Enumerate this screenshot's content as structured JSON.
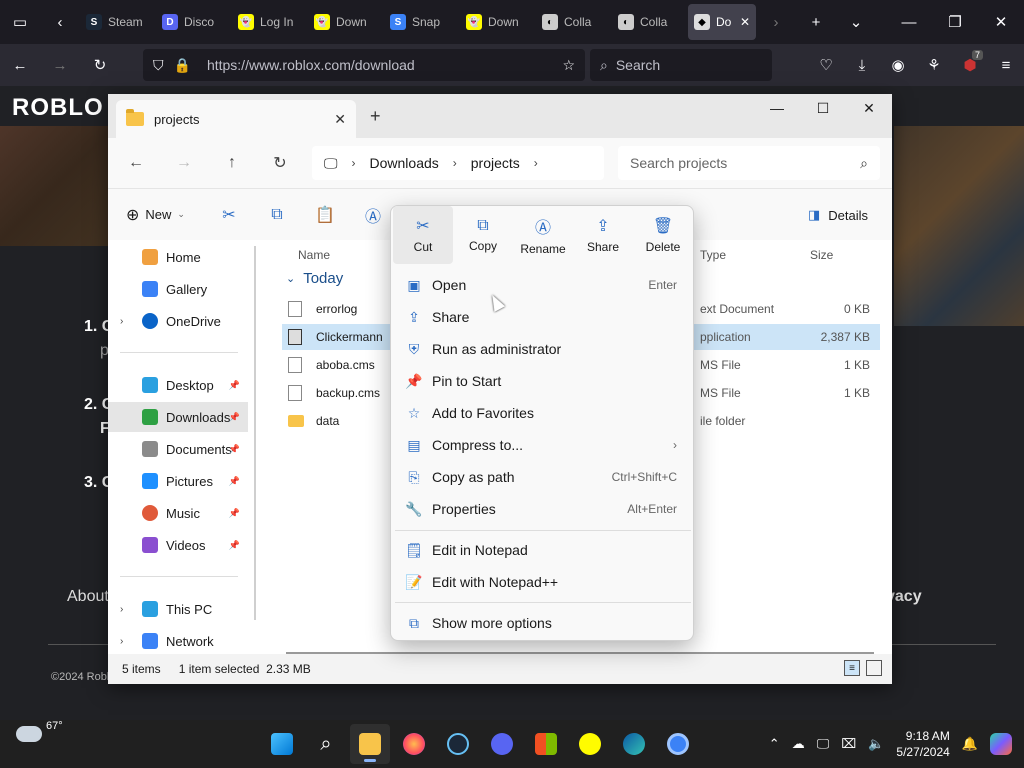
{
  "browser": {
    "tabs": [
      {
        "label": "Steam",
        "color": "#1b2838"
      },
      {
        "label": "Disco",
        "color": "#5865f2"
      },
      {
        "label": "Log In",
        "color": "#fffc00"
      },
      {
        "label": "Down",
        "color": "#fffc00"
      },
      {
        "label": "Snap",
        "color": "#3b82f6"
      },
      {
        "label": "Down",
        "color": "#fffc00"
      },
      {
        "label": "Colla",
        "color": "#cccccc"
      },
      {
        "label": "Colla",
        "color": "#cccccc"
      },
      {
        "label": "Do",
        "color": "#dddddd"
      }
    ],
    "url": "https://www.roblox.com/download",
    "search_placeholder": "Search",
    "notification_count": "7"
  },
  "page": {
    "logo": "ROBLO",
    "steps": [
      "1. C",
      "2. C",
      "3. C"
    ],
    "step_sub": [
      "p",
      "F"
    ],
    "footer_links": [
      "About",
      "vacy"
    ],
    "copyright": "©2024 Roblo",
    "right_letter": "o"
  },
  "explorer": {
    "tab_title": "projects",
    "breadcrumbs": [
      "Downloads",
      "projects"
    ],
    "search_placeholder": "Search projects",
    "new_label": "New",
    "details_label": "Details",
    "sidebar": {
      "home": "Home",
      "gallery": "Gallery",
      "onedrive": "OneDrive",
      "desktop": "Desktop",
      "downloads": "Downloads",
      "documents": "Documents",
      "pictures": "Pictures",
      "music": "Music",
      "videos": "Videos",
      "thispc": "This PC",
      "network": "Network"
    },
    "columns": {
      "name": "Name",
      "type": "Type",
      "size": "Size"
    },
    "group_label": "Today",
    "files": [
      {
        "name": "errorlog",
        "type": "ext Document",
        "size": "0 KB"
      },
      {
        "name": "Clickermann",
        "type": "pplication",
        "size": "2,387 KB"
      },
      {
        "name": "aboba.cms",
        "type": "MS File",
        "size": "1 KB"
      },
      {
        "name": "backup.cms",
        "type": "MS File",
        "size": "1 KB"
      },
      {
        "name": "data",
        "type": "ile folder",
        "size": ""
      }
    ],
    "status": {
      "items": "5 items",
      "selected": "1 item selected",
      "size": "2.33 MB"
    }
  },
  "context_menu": {
    "top_actions": [
      "Cut",
      "Copy",
      "Rename",
      "Share",
      "Delete"
    ],
    "items": [
      {
        "label": "Open",
        "shortcut": "Enter"
      },
      {
        "label": "Share",
        "shortcut": ""
      },
      {
        "label": "Run as administrator",
        "shortcut": ""
      },
      {
        "label": "Pin to Start",
        "shortcut": ""
      },
      {
        "label": "Add to Favorites",
        "shortcut": ""
      },
      {
        "label": "Compress to...",
        "shortcut": "›"
      },
      {
        "label": "Copy as path",
        "shortcut": "Ctrl+Shift+C"
      },
      {
        "label": "Properties",
        "shortcut": "Alt+Enter"
      },
      {
        "label": "Edit in Notepad",
        "shortcut": ""
      },
      {
        "label": "Edit with Notepad++",
        "shortcut": ""
      },
      {
        "label": "Show more options",
        "shortcut": ""
      }
    ]
  },
  "taskbar": {
    "temperature": "67°",
    "time": "9:18 AM",
    "date": "5/27/2024"
  }
}
